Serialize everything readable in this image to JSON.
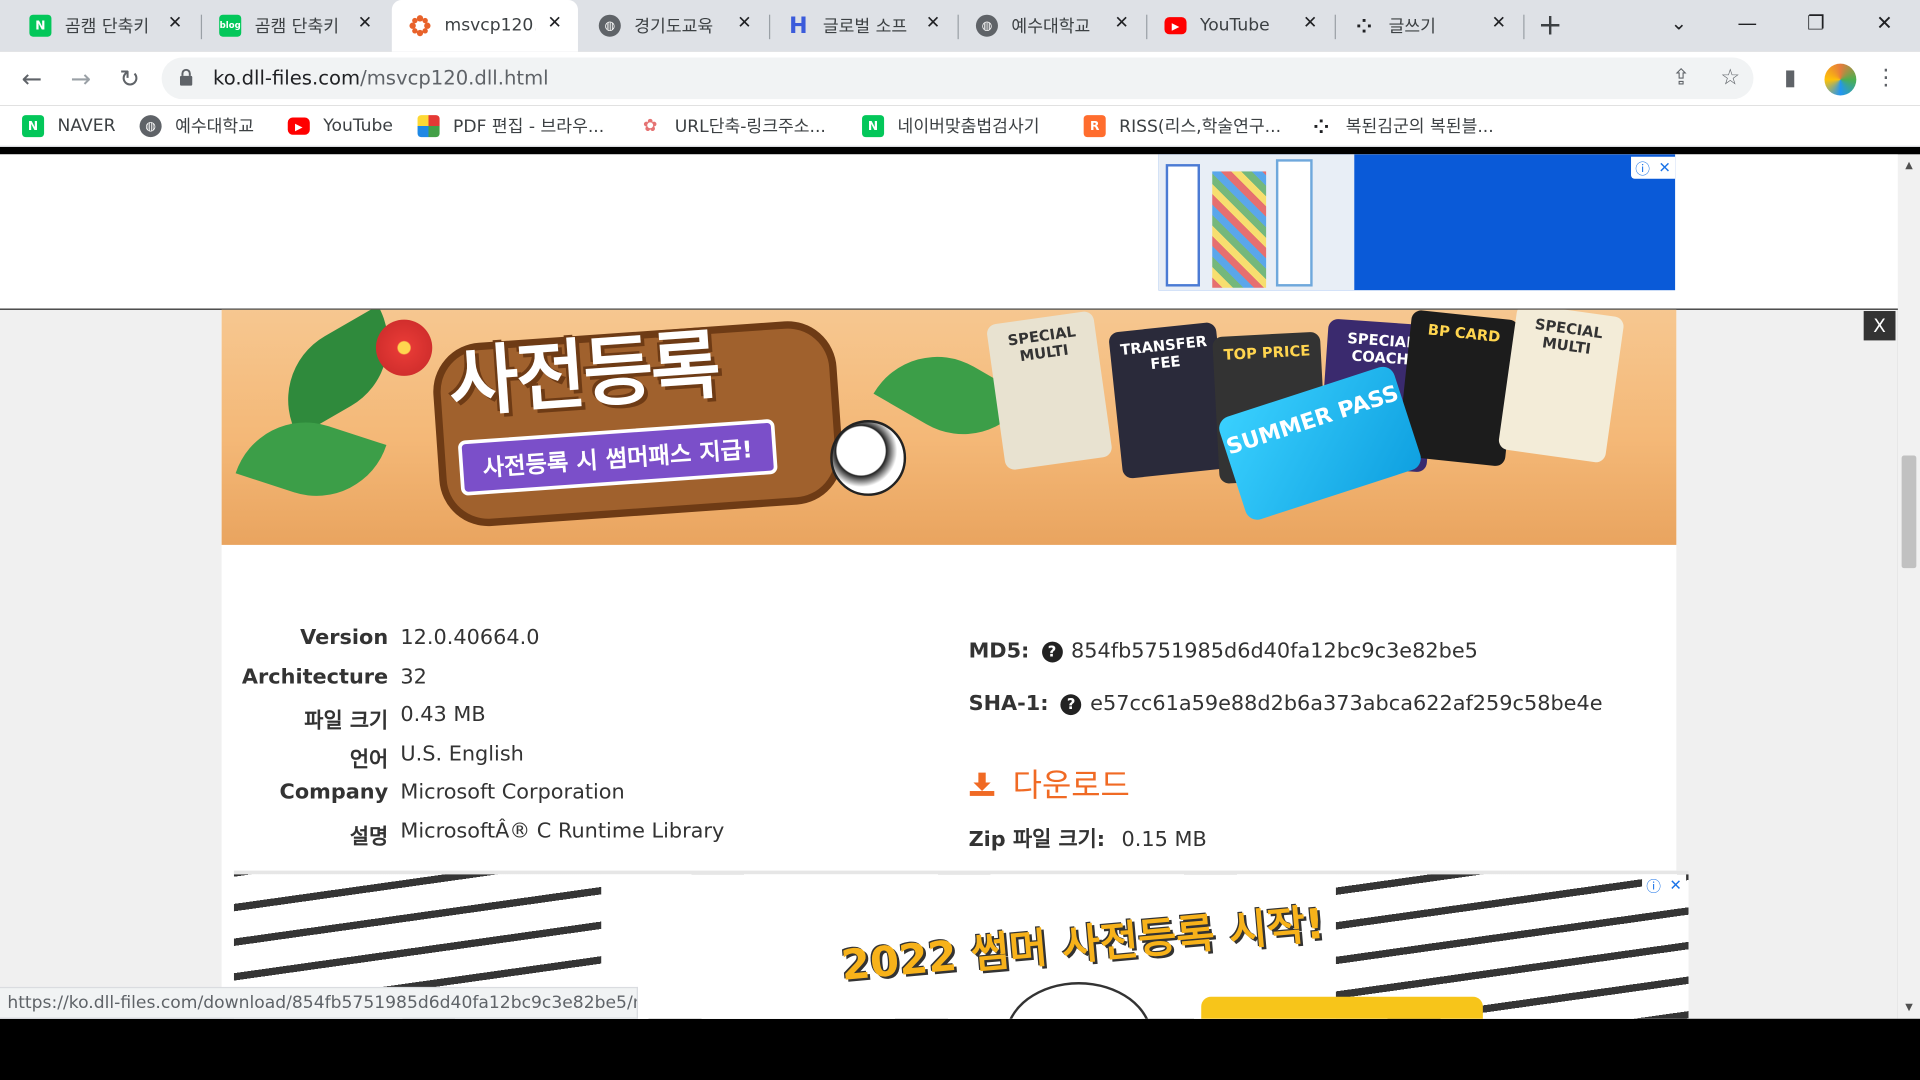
{
  "browser": {
    "tabs": [
      {
        "title": "곰캠 단축키",
        "favicon": "naver-icon"
      },
      {
        "title": "곰캠 단축키",
        "favicon": "blog-icon"
      },
      {
        "title": "msvcp120.dll",
        "favicon": "dll-files-icon"
      },
      {
        "title": "경기도교육",
        "favicon": "globe-icon"
      },
      {
        "title": "글로벌 소프",
        "favicon": "h-icon"
      },
      {
        "title": "예수대학교",
        "favicon": "globe-icon"
      },
      {
        "title": "YouTube",
        "favicon": "youtube-icon"
      },
      {
        "title": "글쓰기",
        "favicon": "dots-icon"
      }
    ],
    "new_tab_label": "+",
    "url_domain": "ko.dll-files.com",
    "url_path": "/msvcp120.dll.html",
    "bookmarks": [
      {
        "label": "NAVER",
        "favicon": "naver-icon"
      },
      {
        "label": "예수대학교",
        "favicon": "globe-icon"
      },
      {
        "label": "YouTube",
        "favicon": "youtube-icon"
      },
      {
        "label": "PDF 편집 - 브라우...",
        "favicon": "pdf-icon"
      },
      {
        "label": "URL단축-링크주소...",
        "favicon": "url-icon"
      },
      {
        "label": "네이버맞춤법검사기",
        "favicon": "naver-icon"
      },
      {
        "label": "RISS(리스,학술연구...",
        "favicon": "riss-icon"
      },
      {
        "label": "복된김군의 복된블...",
        "favicon": "dots-icon"
      }
    ],
    "status_url": "https://ko.dll-files.com/download/854fb5751985d6d40fa12bc9c3e82be5/msvcp120.dll.html"
  },
  "banner": {
    "headline": "사전등록",
    "sub": "사전등록 시 썸머패스 지급!",
    "cards": [
      "SPECIAL MULTI",
      "TRANSFER FEE",
      "TOP PRICE",
      "SPECIAL COACH",
      "BP CARD",
      "SPECIAL MULTI"
    ],
    "ticket": "SUMMER PASS"
  },
  "close_label": "X",
  "file_info": {
    "version_label": "Version",
    "version": "12.0.40664.0",
    "architecture_label": "Architecture",
    "architecture": "32",
    "size_label": "파일 크기",
    "size": "0.43 MB",
    "language_label": "언어",
    "language": "U.S. English",
    "company_label": "Company",
    "company": "Microsoft Corporation",
    "description_label": "설명",
    "description": "MicrosoftÂ® C Runtime Library",
    "md5_label": "MD5:",
    "md5": "854fb5751985d6d40fa12bc9c3e82be5",
    "sha1_label": "SHA-1:",
    "sha1": "e57cc61a59e88d2b6a373abca622af259c58be4e",
    "download_label": "다운로드",
    "zip_label": "Zip 파일 크기:",
    "zip_size": "0.15 MB"
  },
  "bottom_ad": {
    "headline": "2022 썸머 사전등록 시작!"
  },
  "colors": {
    "accent": "#f06a24",
    "tabstrip": "#dee1e6",
    "ad_blue": "#0a5ad8"
  }
}
